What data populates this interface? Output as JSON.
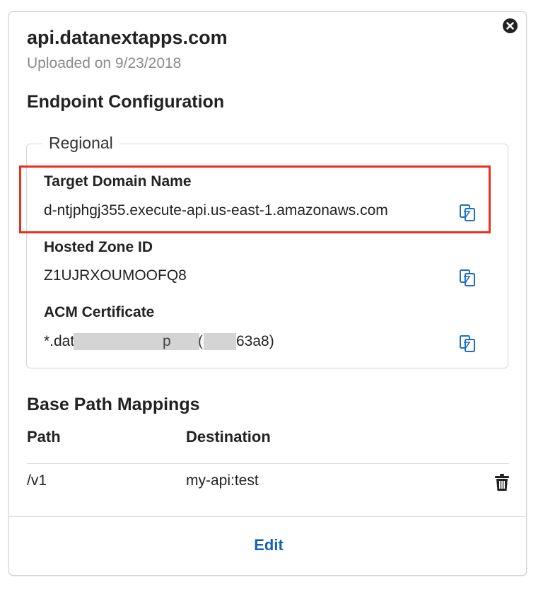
{
  "domain": {
    "title": "api.datanextapps.com",
    "uploaded": "Uploaded on 9/23/2018"
  },
  "endpoint": {
    "heading": "Endpoint Configuration",
    "type_legend": "Regional",
    "fields": [
      {
        "label": "Target Domain Name",
        "value": "d-ntjphgj355.execute-api.us-east-1.amazonaws.com",
        "highlighted": true
      },
      {
        "label": "Hosted Zone ID",
        "value": "Z1UJRXOUMOOFQ8",
        "highlighted": false
      },
      {
        "label": "ACM Certificate",
        "value_prefix": "*.dat",
        "value_mid1": "p",
        "value_mid2": "(",
        "value_suffix": "63a8)",
        "redacted": true
      }
    ]
  },
  "mappings": {
    "heading": "Base Path Mappings",
    "columns": [
      "Path",
      "Destination"
    ],
    "rows": [
      {
        "path": "/v1",
        "destination": "my-api:test"
      }
    ]
  },
  "actions": {
    "edit_label": "Edit"
  },
  "colors": {
    "highlight_border": "#e8301c",
    "link": "#1462b8",
    "copy_icon": "#1f6fc5"
  },
  "icons": [
    "close-icon",
    "copy-icon",
    "trash-icon"
  ]
}
